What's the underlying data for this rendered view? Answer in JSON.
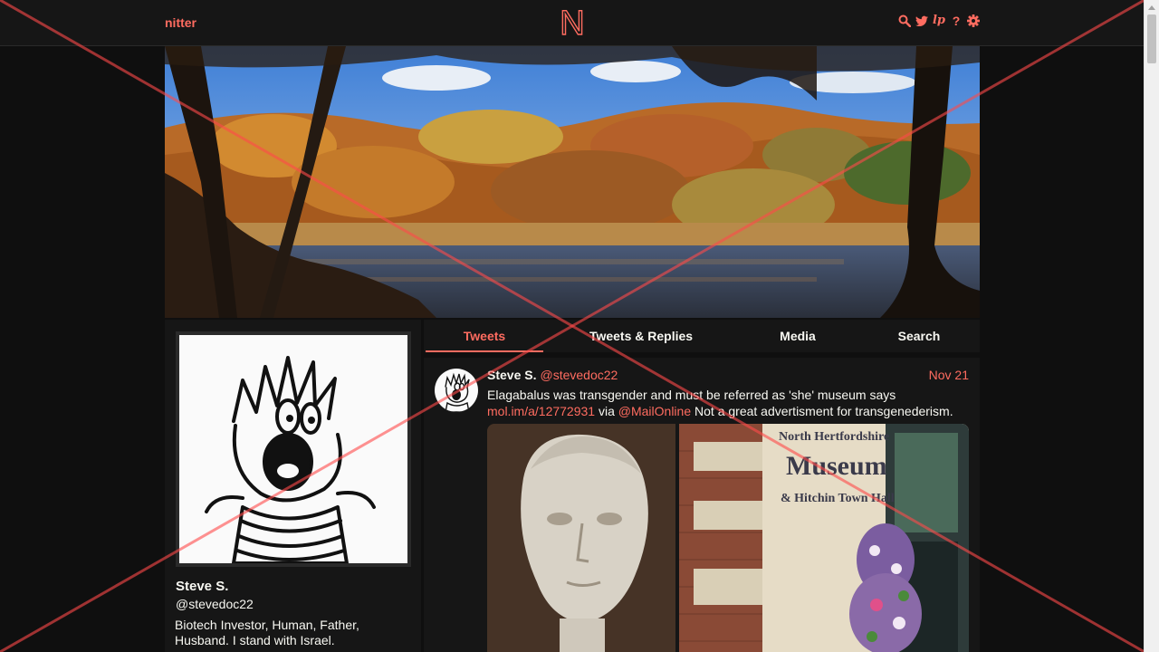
{
  "nav": {
    "brand": "nitter",
    "logo_letter": "N",
    "icons": [
      "search-icon",
      "twitter-bird-icon",
      "liberapay-icon",
      "help-icon",
      "gear-icon"
    ],
    "help_glyph": "?",
    "lp_glyph": "lp"
  },
  "profile": {
    "fullname": "Steve S.",
    "username": "@stevedoc22",
    "bio": "Biotech Investor, Human, Father, Husband. I stand with Israel."
  },
  "tabs": [
    {
      "label": "Tweets",
      "active": true
    },
    {
      "label": "Tweets & Replies",
      "active": false
    },
    {
      "label": "Media",
      "active": false
    },
    {
      "label": "Search",
      "active": false
    }
  ],
  "tweet": {
    "fullname": "Steve S.",
    "username": "@stevedoc22",
    "date": "Nov 21",
    "text_before": "Elagabalus was transgender and must be referred as 'she' museum says",
    "link1": "mol.im/a/12772931",
    "text_mid": " via ",
    "mention": "@MailOnline",
    "text_after": " Not a great advertisment for transgenederism.",
    "sign_lines": [
      "North Hertfordshire",
      "Museum",
      "& Hitchin Town Hall"
    ]
  },
  "colors": {
    "accent": "#ff6c60",
    "background": "#0f0f0f",
    "panel": "#161616",
    "text": "#f8f8f2"
  }
}
